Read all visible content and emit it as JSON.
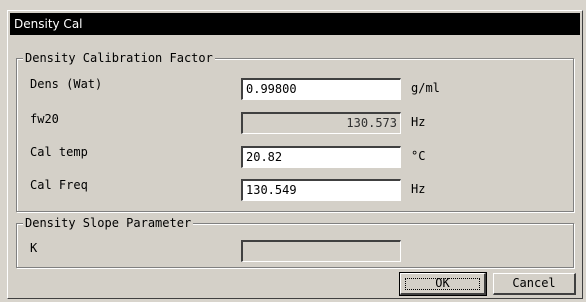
{
  "window": {
    "title": "Density Cal"
  },
  "calibration_group": {
    "title": "Density Calibration Factor",
    "rows": [
      {
        "label": "Dens (Wat)",
        "value": "0.99800",
        "unit": "g/ml"
      },
      {
        "label": "fw20",
        "value": "130.573",
        "unit": "Hz"
      },
      {
        "label": "Cal temp",
        "value": "20.82",
        "unit": "°C"
      },
      {
        "label": "Cal Freq",
        "value": "130.549",
        "unit": "Hz"
      }
    ]
  },
  "slope_group": {
    "title": "Density Slope Parameter",
    "k_label": "K",
    "k_value": ""
  },
  "buttons": {
    "ok": "OK",
    "cancel": "Cancel"
  }
}
